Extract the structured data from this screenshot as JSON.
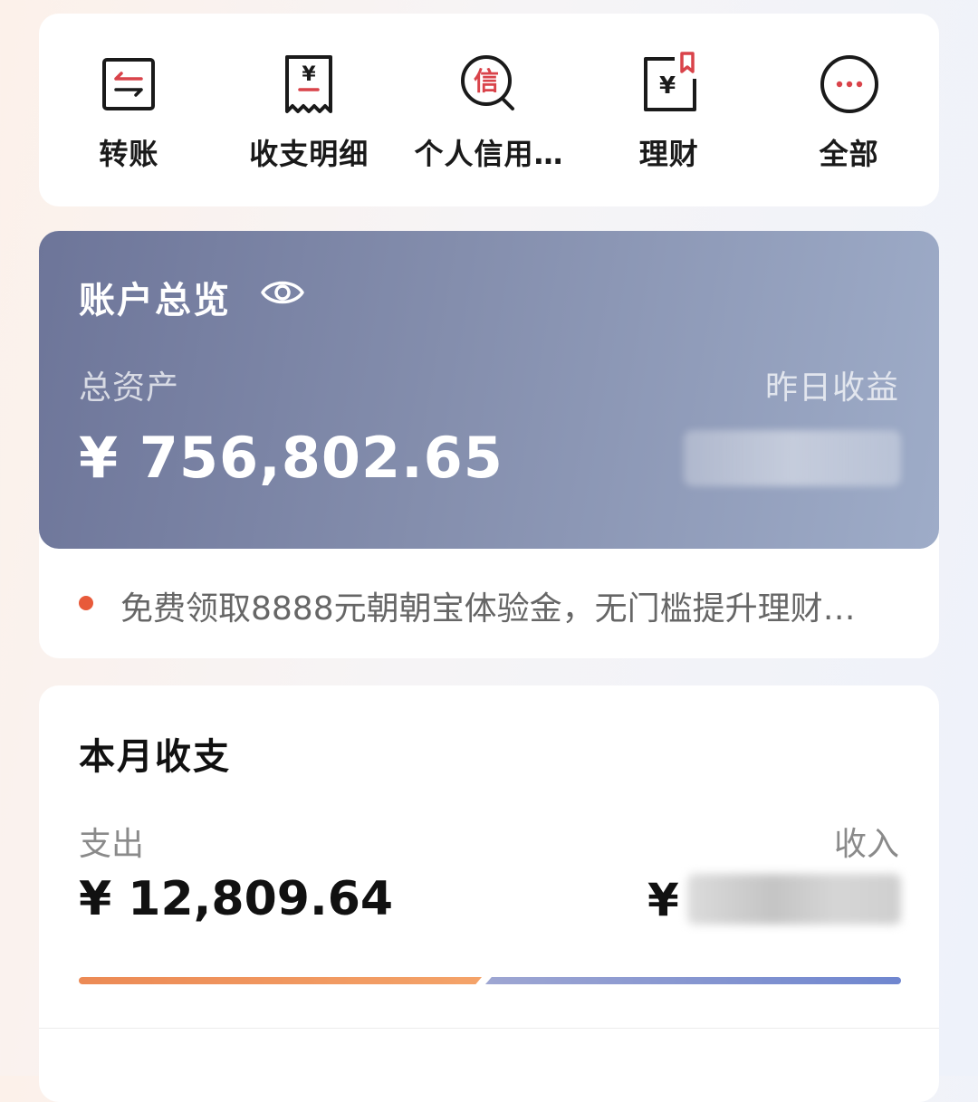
{
  "quick_actions": [
    {
      "label": "转账",
      "icon": "transfer-icon"
    },
    {
      "label": "收支明细",
      "icon": "statement-receipt-icon",
      "glyph": "¥"
    },
    {
      "label": "个人信用…",
      "icon": "credit-magnifier-icon",
      "glyph": "信"
    },
    {
      "label": "理财",
      "icon": "wealth-bookmark-icon",
      "glyph": "¥"
    },
    {
      "label": "全部",
      "icon": "more-dots-icon"
    }
  ],
  "account": {
    "title": "账户总览",
    "visibility_icon": "eye-icon",
    "total_assets_label": "总资产",
    "total_assets": "¥ 756,802.65",
    "yesterday_income_label": "昨日收益",
    "yesterday_income_hidden": true,
    "notice": "免费领取8888元朝朝宝体验金，无门槛提升理财…"
  },
  "monthly": {
    "title": "本月收支",
    "expense_label": "支出",
    "expense": "¥ 12,809.64",
    "income_label": "收入",
    "income_currency": "¥",
    "income_hidden": true,
    "expense_ratio": 0.49
  },
  "colors": {
    "accent_red": "#d9434a",
    "hero_start": "#6d7599",
    "hero_end": "#9eacc8",
    "expense_bar": "#f29a62",
    "income_bar": "#7b8fd0",
    "notice_dot": "#e85a3a"
  }
}
